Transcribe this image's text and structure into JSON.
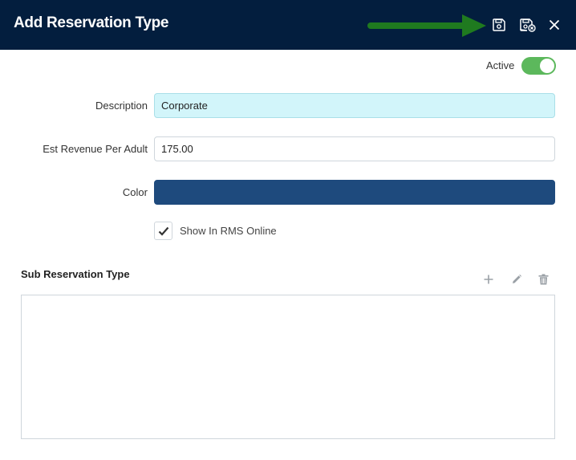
{
  "header": {
    "title": "Add Reservation Type",
    "icons": {
      "save": "save-icon",
      "save_close": "save-close-icon",
      "close": "close-icon"
    }
  },
  "annotation": {
    "type": "arrow",
    "color": "#1f7a1f",
    "points_to": "save-button"
  },
  "active": {
    "label": "Active",
    "enabled": true,
    "color": "#5cb85c"
  },
  "form": {
    "description": {
      "label": "Description",
      "value": "Corporate"
    },
    "est_revenue": {
      "label": "Est Revenue Per Adult",
      "value": "175.00"
    },
    "color": {
      "label": "Color",
      "value_hex": "#1e4a7d"
    },
    "show_online": {
      "label": "Show In RMS Online",
      "checked": true
    }
  },
  "sub_reservation": {
    "title": "Sub Reservation Type",
    "tools": [
      "add-icon",
      "edit-icon",
      "delete-icon"
    ],
    "rows": []
  },
  "colors": {
    "header_bg": "#031e3e",
    "description_bg": "#d2f5fa"
  }
}
